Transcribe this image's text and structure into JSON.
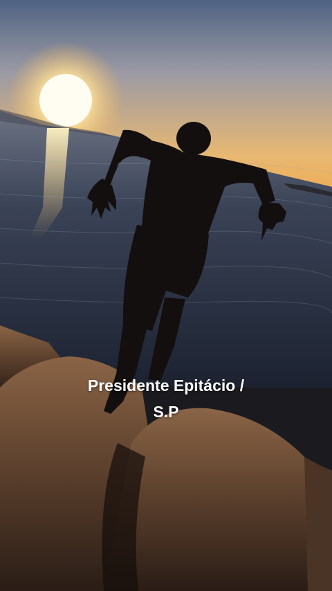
{
  "caption": {
    "line1": "Presidente Epitácio /",
    "line2": "S.P"
  },
  "colors": {
    "sky_top": "#5a6a86",
    "sky_horizon": "#f2b25a",
    "sun": "#fff6d6",
    "water": "#2c3548",
    "rocks": "#5a3f2c",
    "silhouette": "#140f0f"
  }
}
